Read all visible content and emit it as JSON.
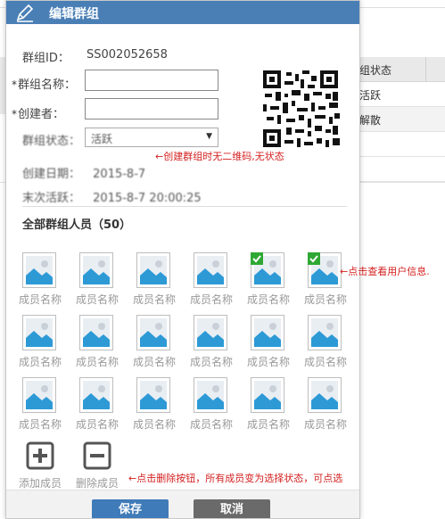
{
  "background": {
    "column_header": "组状态",
    "rows": [
      "活跃",
      "解散"
    ]
  },
  "modal": {
    "title": "编辑群组",
    "group_id_label": "群组ID：",
    "group_id_value": "SS002052658",
    "group_name_label": "群组名称：",
    "group_name_value": "",
    "creator_label": "创建者：",
    "creator_value": "",
    "status_label": "群组状态：",
    "status_value": "活跃",
    "created_date_label": "创建日期：",
    "created_date_value": "2015-8-7",
    "last_active_label": "末次活跃：",
    "last_active_value": "2015-8-7 20:00:25",
    "members_title": "全部群组人员（50）",
    "members": [
      {
        "name": "成员名称",
        "checked": false
      },
      {
        "name": "成员名称",
        "checked": false
      },
      {
        "name": "成员名称",
        "checked": false
      },
      {
        "name": "成员名称",
        "checked": false
      },
      {
        "name": "成员名称",
        "checked": true
      },
      {
        "name": "成员名称",
        "checked": true
      },
      {
        "name": "成员名称",
        "checked": false
      },
      {
        "name": "成员名称",
        "checked": false
      },
      {
        "name": "成员名称",
        "checked": false
      },
      {
        "name": "成员名称",
        "checked": false
      },
      {
        "name": "成员名称",
        "checked": false
      },
      {
        "name": "成员名称",
        "checked": false
      },
      {
        "name": "成员名称",
        "checked": false
      },
      {
        "name": "成员名称",
        "checked": false
      },
      {
        "name": "成员名称",
        "checked": false
      },
      {
        "name": "成员名称",
        "checked": false
      },
      {
        "name": "成员名称",
        "checked": false
      },
      {
        "name": "成员名称",
        "checked": false
      }
    ],
    "add_member_label": "添加成员",
    "remove_member_label": "删除成员",
    "save_label": "保存",
    "cancel_label": "取消"
  },
  "annotations": {
    "qr_note": "←创建群组时无二维码,无状态",
    "member_note": "←点击查看用户信息.",
    "delete_note": "←点击删除按钮，所有成员变为选择状态，可点选"
  },
  "colors": {
    "header_blue": "#4a7fb6",
    "save_blue": "#3f7bb8",
    "cancel_gray": "#6a6a6a",
    "note_red": "#d42020",
    "check_green": "#2fa833",
    "avatar_sky": "#2d9ad6"
  }
}
